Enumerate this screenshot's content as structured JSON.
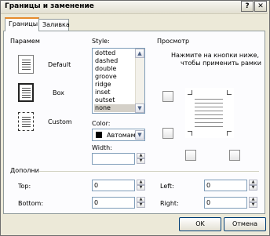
{
  "window": {
    "title": "Границы и заменение"
  },
  "title_buttons": {
    "help": "?",
    "close": "✕"
  },
  "tabs": [
    "Границы",
    "Заливка"
  ],
  "presets": {
    "heading": "Парамем",
    "items": [
      "Default",
      "Box",
      "Custom"
    ]
  },
  "style": {
    "heading": "Style:",
    "options": [
      "dotted",
      "dashed",
      "double",
      "groove",
      "ridge",
      "inset",
      "outset",
      "none"
    ],
    "selected": "none"
  },
  "color": {
    "label": "Color:",
    "value": "Автомам",
    "swatch": "#000000"
  },
  "width": {
    "label": "Width:",
    "value": ""
  },
  "preview": {
    "heading": "Просмотр",
    "instruction_line1": "Нажмите на кнопки ниже,",
    "instruction_line2": "чтобы применить рамки"
  },
  "padding": {
    "heading": "Дополни",
    "top": {
      "label": "Top:",
      "value": "0"
    },
    "bottom": {
      "label": "Bottom:",
      "value": "0"
    },
    "left": {
      "label": "Left:",
      "value": "0"
    },
    "right": {
      "label": "Right:",
      "value": "0"
    }
  },
  "footer": {
    "ok": "OK",
    "cancel": "Отмена"
  }
}
